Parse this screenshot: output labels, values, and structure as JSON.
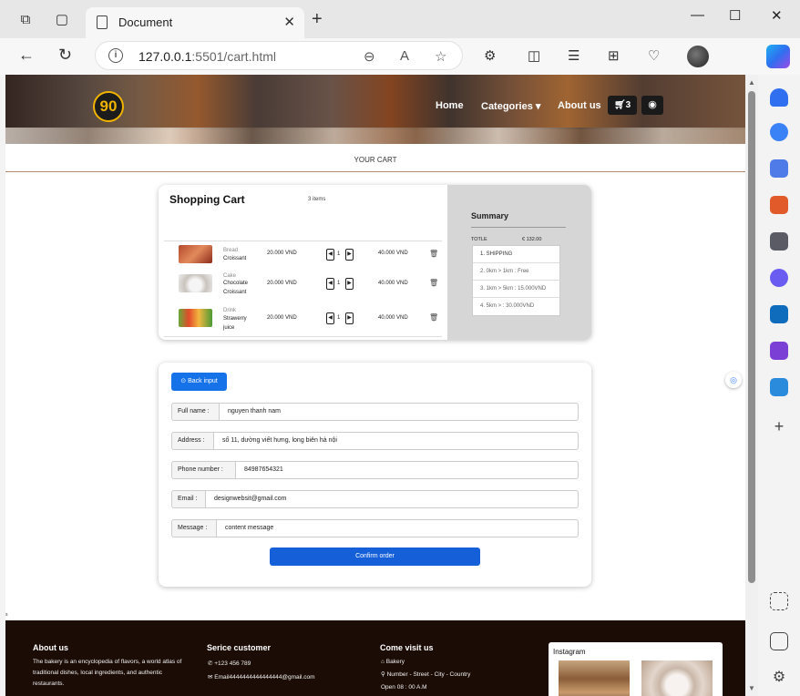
{
  "browser": {
    "tab_title": "Document",
    "url_host": "127.0.0.1",
    "url_rest": ":5501/cart.html"
  },
  "site": {
    "logo_text": "90",
    "nav": {
      "home": "Home",
      "categories": "Categories",
      "about": "About us",
      "cart_count": "3"
    },
    "section_title": "YOUR CART"
  },
  "cart": {
    "title": "Shopping Cart",
    "items_count": "3 items",
    "items": [
      {
        "category": "Bread",
        "name": "Croissant",
        "price": "20.000 VND",
        "qty": "1",
        "total": "40.000 VND"
      },
      {
        "category": "Cake",
        "name": "Chocolate Croissant",
        "name_lines": [
          "Chocolate",
          "Croissant"
        ],
        "price": "20.000 VND",
        "qty": "1",
        "total": "40.000 VND"
      },
      {
        "category": "Drink",
        "name": "Strawerry juice",
        "name_lines": [
          "Strawerry",
          "juice"
        ],
        "price": "20.000 VND",
        "qty": "1",
        "total": "40.000 VND"
      }
    ]
  },
  "summary": {
    "title": "Summary",
    "total_label": "TOTLE",
    "total_value": "€ 132.00",
    "shipping": [
      "1. SHIPPING",
      "2. 0km > 1km : Free",
      "3. 1km > 5km : 15.000VND",
      "4. 5km > : 30.000VND"
    ]
  },
  "form": {
    "back_label": "Back input",
    "fields": [
      {
        "label": "Full name :",
        "value": "nguyen thanh nam"
      },
      {
        "label": "Address :",
        "value": "số 11, dường viết hưng, long biên hà nội"
      },
      {
        "label": "Phone number :",
        "value": "84987654321"
      },
      {
        "label": "Email :",
        "value": "designwebsit@gmail.com"
      },
      {
        "label": "Message :",
        "value": "content message"
      }
    ],
    "confirm_label": "Confirm order"
  },
  "footer": {
    "about_title": "About us",
    "about_text": "The bakery is an encyclopedia of flavors, a world atlas of traditional dishes, local ingredients, and authentic restaurants.",
    "service_title": "Serice customer",
    "phone": "+123 456 789",
    "email": "Email4444444444444444@gmail.com",
    "visit_title": "Come visit us",
    "place": "Bakery",
    "address": "Number - Street - City - Country",
    "hours": "Open 08 : 00 A.M",
    "instagram_title": "Instagram"
  },
  "misc": {
    "stray_char": "s"
  }
}
